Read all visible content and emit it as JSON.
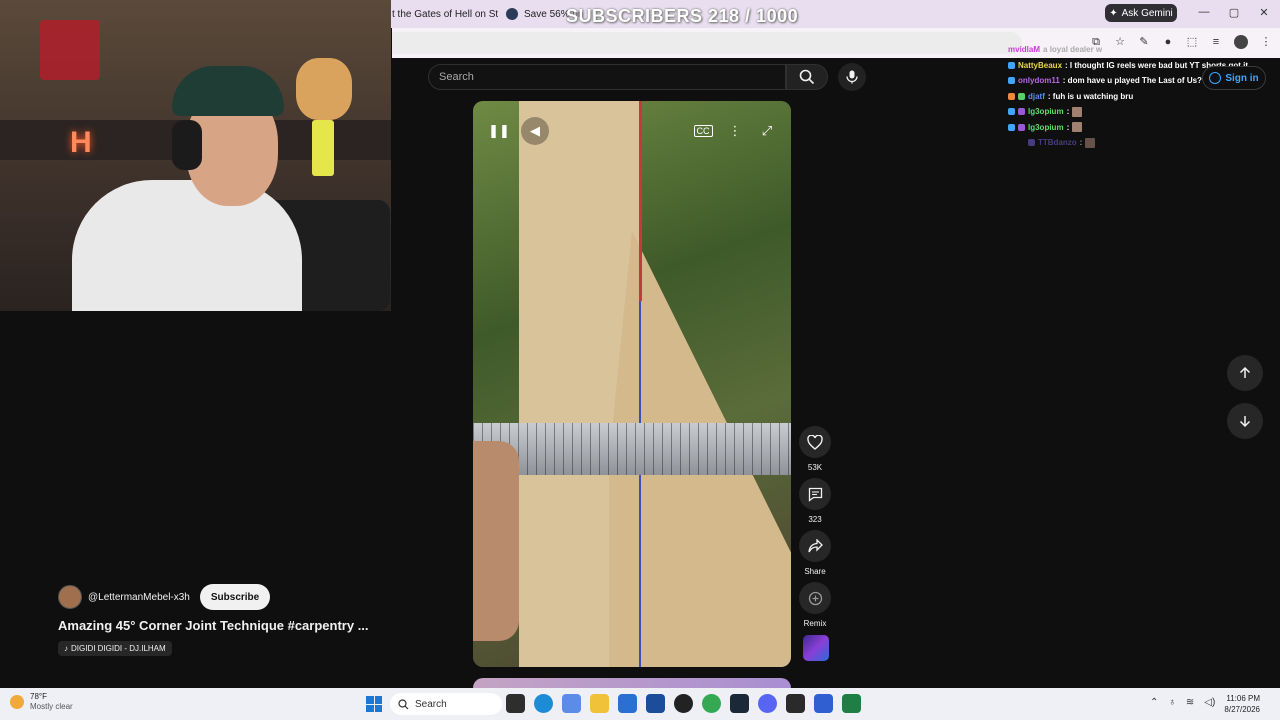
{
  "browser": {
    "tabs": [
      {
        "title": "t the Gates of Hell on St"
      },
      {
        "title": "Save 56% on"
      }
    ],
    "stream_overlay": "SUBSCRIBERS 218 / 1000",
    "ask_gemini": "Ask Gemini"
  },
  "youtube": {
    "search_placeholder": "Search",
    "sign_in": "Sign in"
  },
  "chat": {
    "lines": [
      {
        "user": "mvidlaM",
        "msg": "a loyal dealer w",
        "user_color": "#c93ad8"
      },
      {
        "user": "NattyBeaux",
        "msg": ": I thought IG reels were bad but YT shorts got it",
        "user_color": "#e9d84a"
      },
      {
        "user": "onlydom11",
        "msg": ": dom have u played The Last of Us?",
        "user_color": "#b66ae0"
      },
      {
        "user": "djatf",
        "msg": ": fuh is u watching bru",
        "user_color": "#5a8ff0"
      },
      {
        "user": "lg3opium",
        "msg": ":",
        "user_color": "#59e06a"
      },
      {
        "user": "lg3opium",
        "msg": ":",
        "user_color": "#59e06a"
      },
      {
        "user": "TTBdanzo",
        "msg": ":",
        "user_color": "#6a5ad0"
      }
    ]
  },
  "short": {
    "channel_handle": "@LettermanMebel-x3h",
    "subscribe_label": "Subscribe",
    "title": "Amazing 45° Corner Joint Technique #carpentry ...",
    "music": "DIGIDI DIGIDI - DJ.ILHAM",
    "likes": "53K",
    "comments": "323",
    "share_label": "Share",
    "remix_label": "Remix"
  },
  "taskbar": {
    "temperature": "78°F",
    "weather": "Mostly clear",
    "search_label": "Search",
    "time": "11:06 PM",
    "date": "8/27/2026"
  },
  "colors": {
    "accent_blue": "#3ea6ff",
    "tabbar_bg": "#e9def0",
    "page_bg": "#0f0f0f"
  },
  "icons": [
    "pause-icon",
    "volume-icon",
    "captions-icon",
    "more-icon",
    "fullscreen-icon",
    "like-icon",
    "comment-icon",
    "share-icon",
    "remix-icon",
    "search-icon",
    "mic-icon",
    "arrow-up-icon",
    "arrow-down-icon",
    "account-icon"
  ]
}
